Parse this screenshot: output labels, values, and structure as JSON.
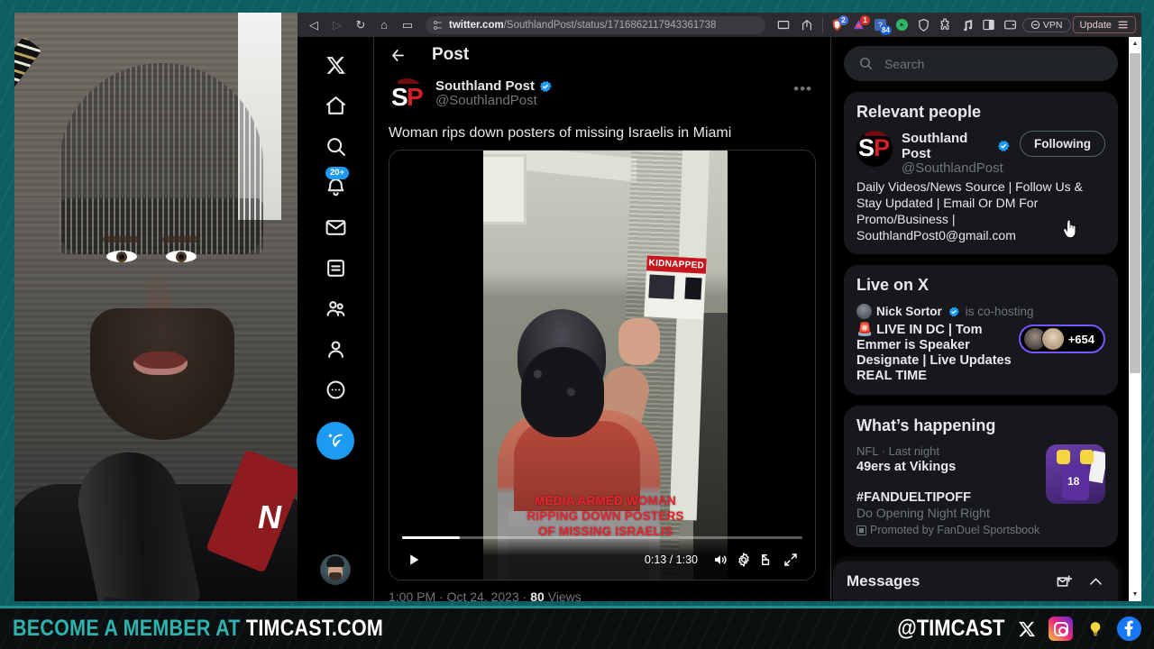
{
  "browser": {
    "url_domain": "twitter.com",
    "url_path": "/SouthlandPost/status/1716862117943361738",
    "nav": {
      "back": "◁",
      "forward": "▷",
      "reload": "↻",
      "home": "⌂",
      "bookmark": "▭"
    },
    "extensions": [
      {
        "name": "brave-shields-icon",
        "badge": "2"
      },
      {
        "name": "extension-warning-icon",
        "badge": "1"
      },
      {
        "name": "extension-blue-icon",
        "badge": "84"
      },
      {
        "name": "extension-green-icon",
        "badge": ""
      },
      {
        "name": "brave-shield-icon",
        "badge": ""
      },
      {
        "name": "puzzle-extensions-icon",
        "badge": ""
      },
      {
        "name": "music-note-icon",
        "badge": ""
      },
      {
        "name": "sidebar-panel-icon",
        "badge": ""
      },
      {
        "name": "wallet-icon",
        "badge": ""
      }
    ],
    "vpn_label": "VPN",
    "update_label": "Update"
  },
  "xnav": {
    "items": [
      {
        "name": "x-logo",
        "label": "X",
        "badge": ""
      },
      {
        "name": "home",
        "label": "Home",
        "badge": ""
      },
      {
        "name": "explore",
        "label": "Explore",
        "badge": ""
      },
      {
        "name": "notifications",
        "label": "Notifications",
        "badge": "20+"
      },
      {
        "name": "messages",
        "label": "Messages",
        "badge": ""
      },
      {
        "name": "lists",
        "label": "Lists",
        "badge": ""
      },
      {
        "name": "communities",
        "label": "Communities",
        "badge": ""
      },
      {
        "name": "profile",
        "label": "Profile",
        "badge": ""
      },
      {
        "name": "more",
        "label": "More",
        "badge": ""
      }
    ],
    "compose_label": "Post"
  },
  "main": {
    "header_title": "Post",
    "author": {
      "display_name": "Southland Post",
      "handle": "@SouthlandPost",
      "verified": true,
      "avatar_initials_left": "S",
      "avatar_initials_right": "P"
    },
    "post_text": "Woman rips down posters of missing Israelis in Miami",
    "video": {
      "overlay_line1": "MEDIA ARMED WOMAN",
      "overlay_line2": "RIPPING DOWN POSTERS",
      "overlay_line3": "OF MISSING ISRAELIS",
      "poster_text": "KIDNAPPED",
      "current_time": "0:13",
      "duration": "1:30",
      "time_display": "0:13 / 1:30",
      "progress_percent": 14,
      "play_label": "Play",
      "volume_label": "Mute",
      "settings_label": "Settings",
      "pip_label": "Picture in picture",
      "fullscreen_label": "Full screen"
    },
    "meta_time": "1:00 PM",
    "meta_date": "Oct 24, 2023",
    "meta_views_count": "80",
    "meta_views_label": "Views",
    "meta_separator": "·"
  },
  "sidebar": {
    "search_placeholder": "Search",
    "relevant_people": {
      "title": "Relevant people",
      "person": {
        "display_name": "Southland Post",
        "handle": "@SouthlandPost",
        "follow_label": "Following",
        "bio": "Daily Videos/News Source | Follow Us & Stay Updated | Email Or DM For Promo/Business | SouthlandPost0@gmail.com",
        "avatar_initials_left": "S",
        "avatar_initials_right": "P"
      }
    },
    "live_on_x": {
      "title": "Live on X",
      "host_name": "Nick Sortor",
      "host_status": "is co-hosting",
      "stream_title": "🚨 LIVE IN DC | Tom Emmer is Speaker Designate | Live Updates REAL TIME",
      "listener_count": "+654"
    },
    "whats_happening": {
      "title": "What’s happening",
      "trend": {
        "category": "NFL · Last night",
        "title": "49ers at Vikings",
        "thumb_number": "18"
      },
      "promoted": {
        "hashtag": "#FANDUELTIPOFF",
        "subtitle": "Do Opening Night Right",
        "promoted_by": "Promoted by FanDuel Sportsbook"
      }
    },
    "messages": {
      "title": "Messages",
      "new_message_label": "New message",
      "expand_label": "Expand"
    }
  },
  "banner": {
    "left_prefix": "BECOME A MEMBER AT",
    "left_brand": "TIMCAST.COM",
    "handle": "@TIMCAST",
    "socials": [
      {
        "name": "x-icon",
        "glyph": "✕"
      },
      {
        "name": "instagram-icon",
        "glyph": ""
      },
      {
        "name": "lightbulb-icon",
        "glyph": "💡"
      },
      {
        "name": "facebook-icon",
        "glyph": "f"
      }
    ]
  },
  "colors": {
    "accent_teal": "#1f8f92",
    "x_blue": "#1d9bf0",
    "live_purple": "#7856ff",
    "brand_red": "#d61f26"
  }
}
